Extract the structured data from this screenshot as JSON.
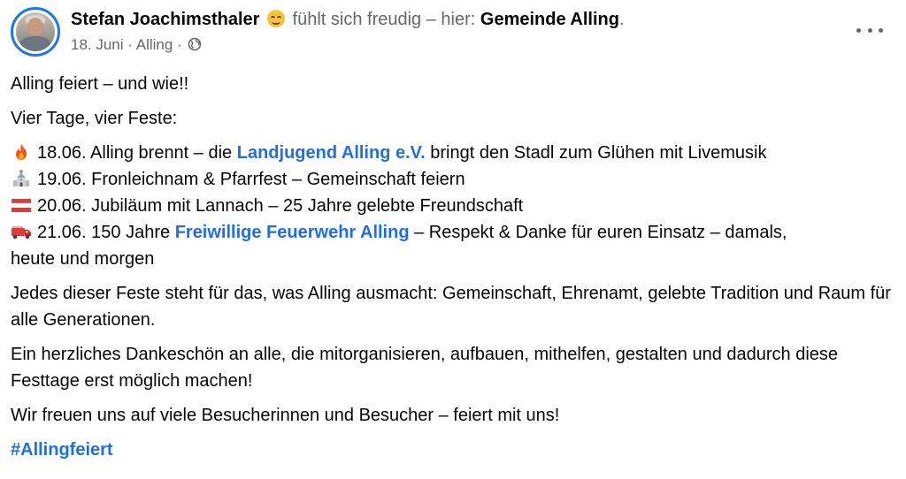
{
  "post": {
    "author": "Stefan Joachimsthaler",
    "feeling_text": "fühlt sich freudig – hier:",
    "place": "Gemeinde Alling",
    "place_suffix": ".",
    "date": "18. Juni",
    "separator": "·",
    "location": "Alling",
    "privacy_icon": "globe-icon",
    "more_icon": "more-options-icon"
  },
  "content": {
    "headline": "Alling feiert – und wie!!",
    "intro": "Vier Tage, vier Feste:",
    "items": [
      {
        "icon": "fire-icon",
        "text_before": "18.06. Alling brennt – die ",
        "link": "Landjugend Alling e.V.",
        "text_after": " bringt den Stadl zum Glühen mit Livemusik"
      },
      {
        "icon": "church-icon",
        "text": "19.06. Fronleichnam & Pfarrfest – Gemeinschaft feiern"
      },
      {
        "icon": "austria-flag-icon",
        "text": "20.06. Jubiläum mit Lannach – 25 Jahre gelebte Freundschaft"
      },
      {
        "icon": "fire-truck-icon",
        "text_before": "21.06. 150 Jahre ",
        "link": "Freiwillige Feuerwehr Alling",
        "text_after": " – Respekt & Danke für euren Einsatz –  damals,",
        "continuation": "heute und morgen"
      }
    ],
    "paragraph1": "Jedes dieser Feste steht für das, was Alling ausmacht: Gemeinschaft, Ehrenamt, gelebte Tradition und Raum für alle Generationen.",
    "paragraph2": "Ein herzliches Dankeschön an alle, die mitorganisieren, aufbauen, mithelfen, gestalten und dadurch diese Festtage erst möglich machen!",
    "paragraph3": "Wir freuen uns auf viele Besucherinnen und Besucher – feiert mit uns!",
    "hashtag": "#Allingfeiert"
  },
  "colors": {
    "link": "#216fdb",
    "secondary_text": "#65676b",
    "avatar_ring": "#1877f2"
  }
}
